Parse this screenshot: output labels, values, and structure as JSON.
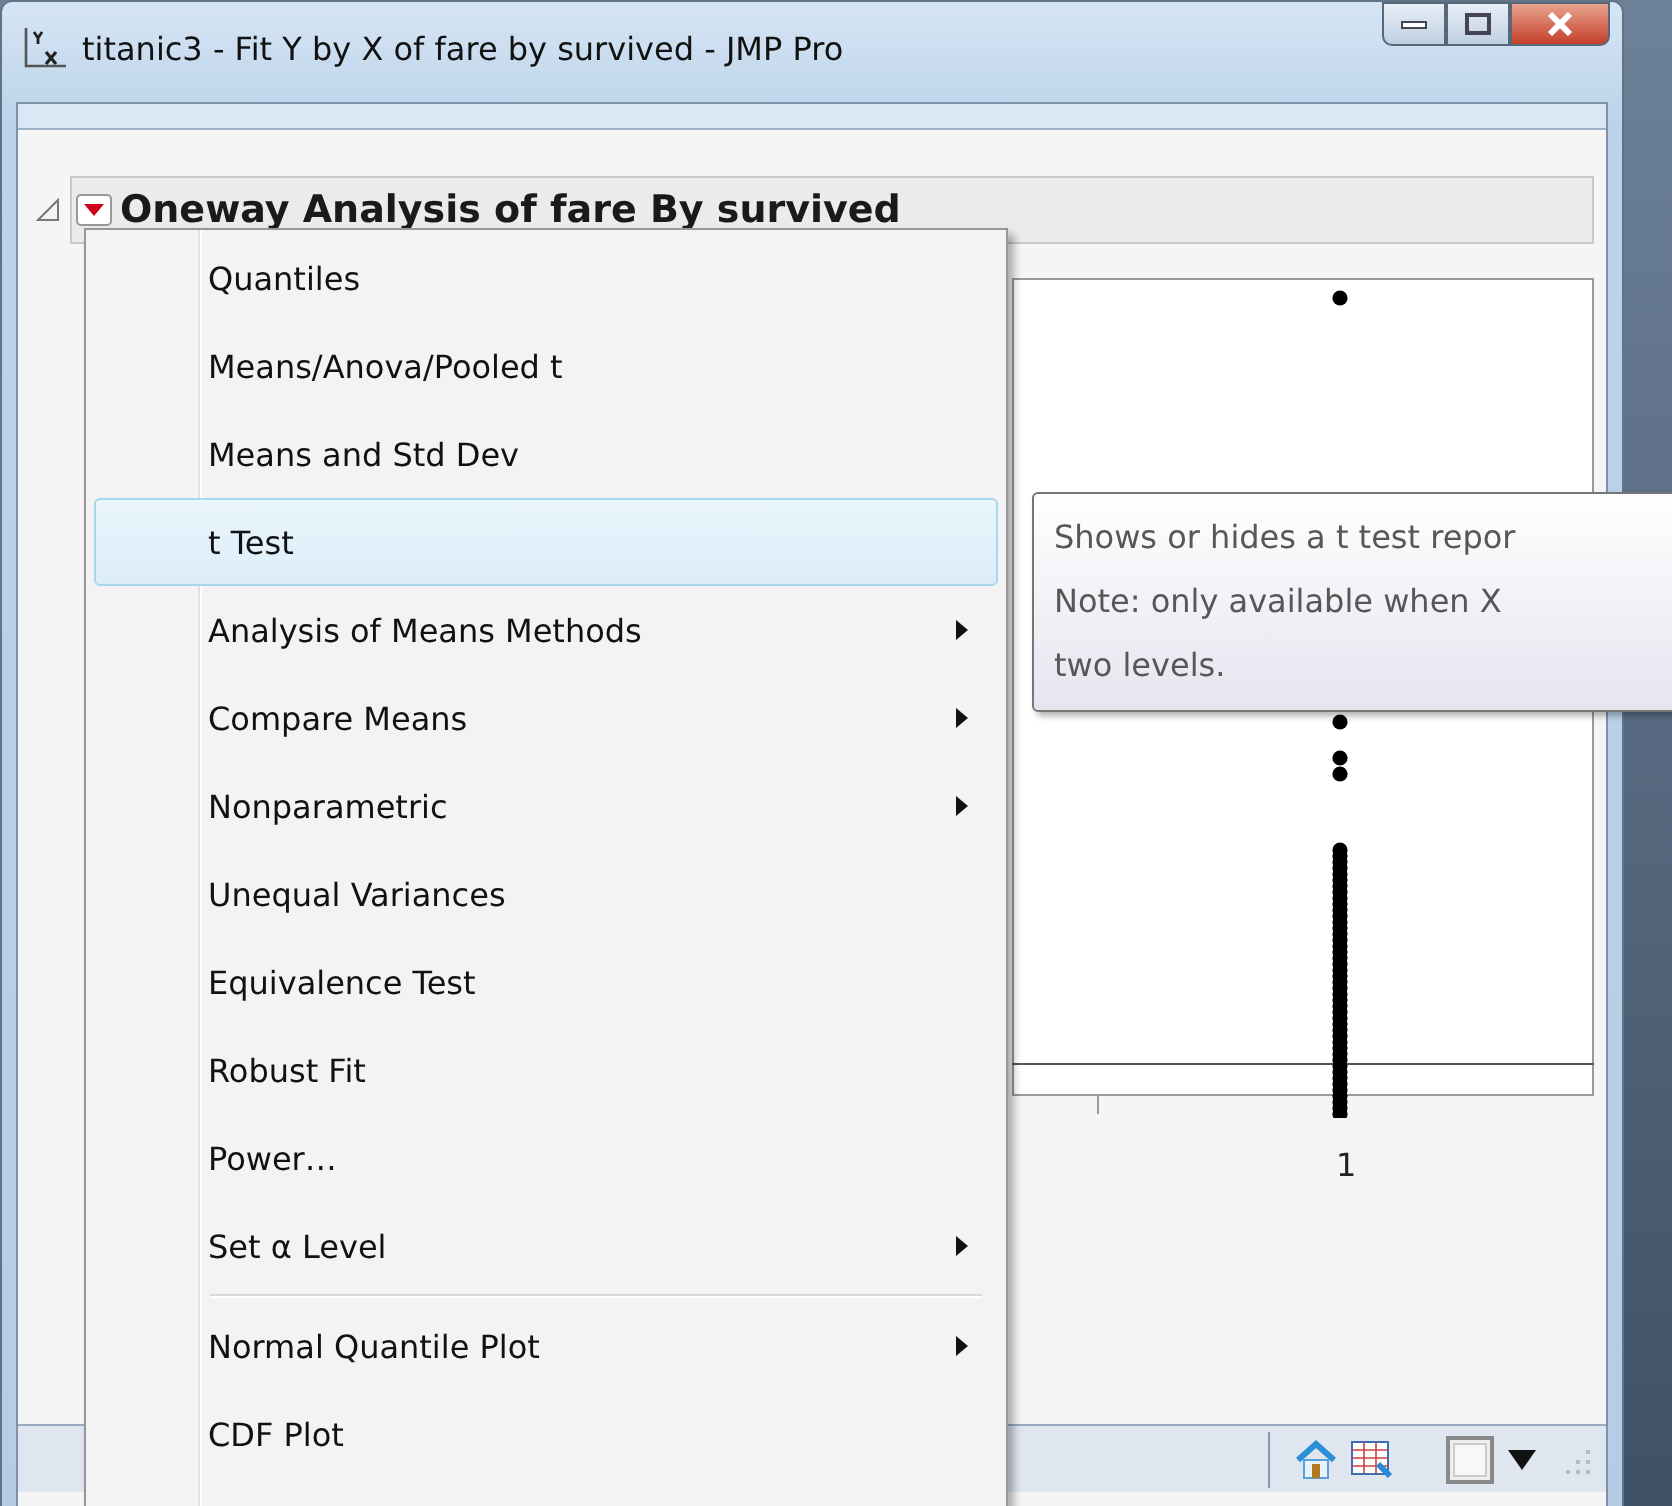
{
  "window": {
    "title": "titanic3 - Fit Y by X of fare by survived - JMP Pro"
  },
  "report": {
    "title": "Oneway Analysis of fare By survived",
    "plot": {
      "kind": "picture",
      "tick_label": "1"
    }
  },
  "menu": {
    "items": [
      {
        "kind": "item",
        "label": "Quantiles",
        "submenu": false,
        "selected": false
      },
      {
        "kind": "item",
        "label": "Means/Anova/Pooled t",
        "submenu": false,
        "selected": false
      },
      {
        "kind": "item",
        "label": "Means and Std Dev",
        "submenu": false,
        "selected": false
      },
      {
        "kind": "item",
        "label": "t Test",
        "submenu": false,
        "selected": true
      },
      {
        "kind": "item",
        "label": "Analysis of Means Methods",
        "submenu": true,
        "selected": false
      },
      {
        "kind": "item",
        "label": "Compare Means",
        "submenu": true,
        "selected": false
      },
      {
        "kind": "item",
        "label": "Nonparametric",
        "submenu": true,
        "selected": false
      },
      {
        "kind": "item",
        "label": "Unequal Variances",
        "submenu": false,
        "selected": false
      },
      {
        "kind": "item",
        "label": "Equivalence Test",
        "submenu": false,
        "selected": false
      },
      {
        "kind": "item",
        "label": "Robust Fit",
        "submenu": false,
        "selected": false
      },
      {
        "kind": "item",
        "label": "Power…",
        "submenu": false,
        "selected": false
      },
      {
        "kind": "item",
        "label": "Set α Level",
        "submenu": true,
        "selected": false
      },
      {
        "kind": "separator"
      },
      {
        "kind": "item",
        "label": "Normal Quantile Plot",
        "submenu": true,
        "selected": false
      },
      {
        "kind": "item",
        "label": "CDF Plot",
        "submenu": false,
        "selected": false
      }
    ]
  },
  "tooltip": {
    "lines": [
      "Shows or hides a t test repor",
      "Note: only available when X",
      "two levels."
    ]
  }
}
